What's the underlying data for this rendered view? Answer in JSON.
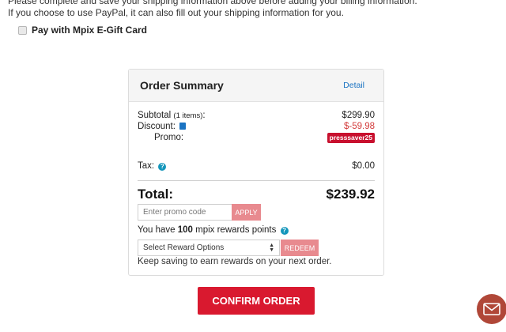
{
  "intro": {
    "line1": "Please complete and save your shipping information above before adding your billing information.",
    "line2": "If you choose to use PayPal, it can also fill out your shipping information for you."
  },
  "gift_card": {
    "label": "Pay with Mpix E-Gift Card",
    "checked": false
  },
  "order_summary": {
    "title": "Order Summary",
    "detail_link": "Detail",
    "subtotal_label": "Subtotal",
    "subtotal_items": "(1 items)",
    "subtotal_colon": ":",
    "subtotal_value": "$299.90",
    "discount_label": "Discount:",
    "discount_value": "$-59.98",
    "promo_label": "Promo:",
    "promo_code": "presssaver25",
    "tax_label": "Tax:",
    "tax_value": "$0.00",
    "total_label": "Total:",
    "total_value": "$239.92",
    "promo_input_placeholder": "Enter promo code",
    "apply_button": "APPLY",
    "rewards_prefix": "You have ",
    "rewards_points": "100",
    "rewards_suffix": " mpix rewards points",
    "reward_select_value": "Select Reward Options",
    "redeem_button": "REDEEM",
    "keep_saving": "Keep saving to earn rewards on your next order."
  },
  "confirm_button": "CONFIRM ORDER",
  "icons": {
    "trash": "trash-icon",
    "help": "question-circle-icon",
    "chat": "mail-envelope-icon"
  },
  "colors": {
    "primary_red": "#d9192f",
    "button_pink": "#e88a8f",
    "link_blue": "#1a73c2",
    "chat_bg": "#b04738"
  }
}
